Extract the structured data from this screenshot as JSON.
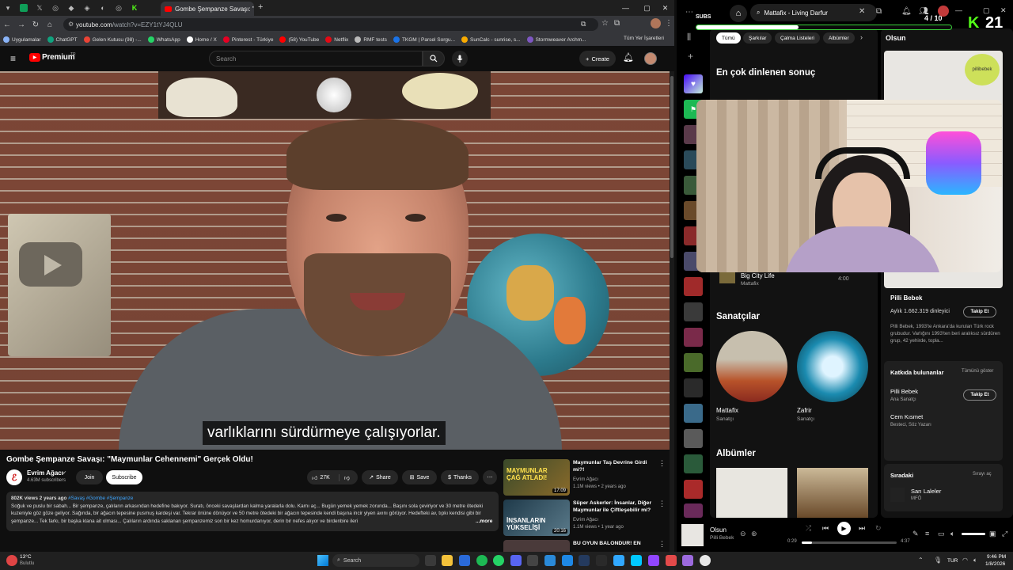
{
  "browser": {
    "active_tab_title": "Gombe Şempanze Savaşı: \"Ma...",
    "url_host": "youtube.com",
    "url_path": "/watch?v=EZY1tYJ4QLU",
    "bookmarks_all": "Tüm Yer İşaretleri",
    "bookmarks": [
      {
        "label": "Uygulamalar",
        "color": "#8ab4f8"
      },
      {
        "label": "ChatGPT",
        "color": "#10a37f"
      },
      {
        "label": "Gelen Kutusu (98) -...",
        "color": "#ea4335"
      },
      {
        "label": "WhatsApp",
        "color": "#25d366"
      },
      {
        "label": "Home / X",
        "color": "#ffffff"
      },
      {
        "label": "Pinterest - Türkiye",
        "color": "#e60023"
      },
      {
        "label": "(58) YouTube",
        "color": "#ff0000"
      },
      {
        "label": "Netflix",
        "color": "#e50914"
      },
      {
        "label": "RMF tests",
        "color": "#bbbbbb"
      },
      {
        "label": "TKGM | Parsel Sorgu...",
        "color": "#1a73e8"
      },
      {
        "label": "SunCalc - sunrise, s...",
        "color": "#f9ab00"
      },
      {
        "label": "Stormweaver Archm...",
        "color": "#7e57c2"
      }
    ]
  },
  "youtube": {
    "logo": "Premium",
    "logo_sup": "TR",
    "search_placeholder": "Search",
    "create_label": "Create",
    "subtitle": "varlıklarını sürdürmeye çalışıyorlar.",
    "video_title": "Gombe Şempanze Savaşı: \"Maymunlar Cehennemi\" Gerçek Oldu!",
    "channel_name": "Evrim Ağacı",
    "subscribers": "4.63M subscribers",
    "join": "Join",
    "subscribe": "Subscribe",
    "likes": "27K",
    "share": "Share",
    "save": "Save",
    "thanks": "Thanks",
    "desc_meta": "802K views  2 years ago",
    "desc_tags": "#Savaş #Gombe #Şempanze",
    "desc_text": "Soğuk ve puslu bir sabah... Bir şempanze, çalıların arkasından hedefine bakıyor. Suratı, önceki savaşlardan kalma yaralarla dolu. Karnı aç... Bugün yemek yemek zorunda... Başını sola çeviriyor ve 30 metre ötedeki kuzeniyle göz göze geliyor. Sağında, bir ağacın tepesine pusmuş kardeşi var. Tekrar önüne dönüyor ve 50 metre ötedeki bir ağacın tepesinde kendi başına incir yiyen avını görüyor. Hedefteki av, tıpkı kendisi gibi bir şempanze... Tek farkı, bir başka klana ait olması... Çalıların ardında saklanan şempanzemiz son bir kez homurdanıyor, derin bir nefes alıyor ve birdenbire ileri",
    "desc_more": "...more",
    "recommendations": [
      {
        "title": "Maymunlar Taş Devrine Girdi mi?!",
        "channel": "Evrim Ağacı",
        "meta": "1.1M views • 2 years ago",
        "duration": "17:09",
        "thumb_text": "MAYMUNLAR ÇAĞ ATLADI!"
      },
      {
        "title": "Süper Askerler: İnsanlar, Diğer Maymunlar ile Çiftleşebilir mi?",
        "channel": "Evrim Ağacı",
        "meta": "1.1M views • 1 year ago",
        "duration": "20:16",
        "thumb_text": "İNSANLARIN YÜKSELİŞİ"
      },
      {
        "title": "BU OYUN BALONDUR! EN",
        "channel": "",
        "meta": "",
        "duration": "",
        "thumb_text": ""
      }
    ]
  },
  "spotify": {
    "search_text": "Mattafix - Living Darfur",
    "subs_label": "SUBS",
    "subs_count": "4 / 10",
    "subs_progress": 0.4,
    "kick_count": "21",
    "chips": [
      "Tümü",
      "Şarkılar",
      "Çalma Listeleri",
      "Albümler"
    ],
    "top_result_title": "En çok dinlenen sonuç",
    "track": {
      "title": "Big City Life",
      "artist": "Mattafix",
      "duration": "4:00"
    },
    "artists_title": "Sanatçılar",
    "artists": [
      {
        "name": "Mattafix",
        "role": "Sanatçı"
      },
      {
        "name": "Zafrir",
        "role": "Sanatçı"
      }
    ],
    "albums_title": "Albümler",
    "right_title": "Olsun",
    "artist_panel": {
      "name": "Pilli Bebek",
      "listeners": "Aylık 1.662.319 dinleyici",
      "follow": "Takip Et",
      "bio": "Pilli Bebek, 1993'te Ankara'da kurulan Türk rock grubudur. Varlığını 1993'ten beri aralıksız sürdüren grup, 42 yehirde, topla...",
      "logo_text": "pillibebek"
    },
    "credits": {
      "title": "Katkıda bulunanlar",
      "show_all": "Tümünü göster",
      "items": [
        {
          "name": "Pilli Bebek",
          "role": "Ana Sanatçı",
          "follow": "Takip Et"
        },
        {
          "name": "Cem Kısmet",
          "role": "Besteci, Söz Yazarı",
          "follow": ""
        }
      ]
    },
    "queue": {
      "title": "Sıradaki",
      "open": "Sırayı aç",
      "item_title": "Sarı Laleler",
      "item_artist": "MFÖ"
    },
    "now_playing": {
      "title": "Olsun",
      "artist": "Pilli Bebek",
      "elapsed": "0:29",
      "total": "4:37",
      "progress": 0.105
    }
  },
  "taskbar": {
    "weather_temp": "13°C",
    "weather_desc": "Bulutlu",
    "search": "Search",
    "lang": "TUR",
    "time": "9:46 PM",
    "date": "1/8/2026"
  }
}
